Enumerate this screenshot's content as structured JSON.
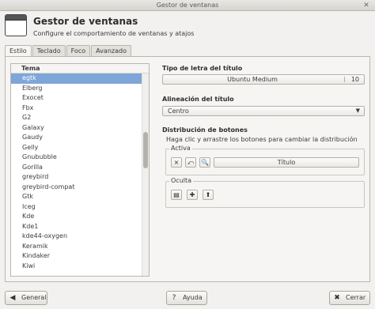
{
  "window": {
    "title": "Gestor de ventanas"
  },
  "header": {
    "title": "Gestor de ventanas",
    "subtitle": "Configure el comportamiento de ventanas y atajos"
  },
  "tabs": [
    {
      "label": "Estilo"
    },
    {
      "label": "Teclado"
    },
    {
      "label": "Foco"
    },
    {
      "label": "Avanzado"
    }
  ],
  "theme_list": {
    "header": "Tema",
    "items": [
      "egtk",
      "Elberg",
      "Exocet",
      "Fbx",
      "G2",
      "Galaxy",
      "Gaudy",
      "Gelly",
      "Gnububble",
      "Gorilla",
      "greybird",
      "greybird-compat",
      "Gtk",
      "Iceg",
      "Kde",
      "Kde1",
      "kde44-oxygen",
      "Keramik",
      "Kindaker",
      "Kiwi"
    ],
    "selected": "egtk"
  },
  "title_font": {
    "label": "Tipo de letra del título",
    "name": "Ubuntu Medium",
    "size": "10"
  },
  "title_alignment": {
    "label": "Alineación del título",
    "value": "Centro"
  },
  "buttons_layout": {
    "label": "Distribución de botones",
    "description": "Haga clic y arrastre los botones para cambiar la distribución",
    "active_label": "Activa",
    "active_buttons": [
      "×",
      "⤺",
      "🔍"
    ],
    "title_button": "Título",
    "hidden_label": "Oculta",
    "hidden_buttons": [
      "▤",
      "✚",
      "⬆"
    ]
  },
  "footer": {
    "general": "General",
    "help": "Ayuda",
    "close": "Cerrar"
  }
}
